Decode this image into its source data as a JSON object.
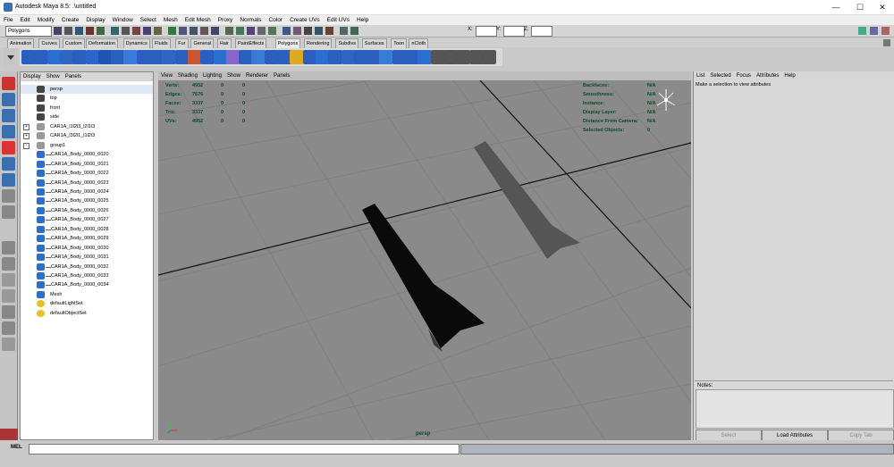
{
  "window": {
    "title": "Autodesk Maya 8.5: .\\untitled",
    "minimize": "—",
    "maximize": "☐",
    "close": "✕"
  },
  "menubar": [
    "File",
    "Edit",
    "Modify",
    "Create",
    "Display",
    "Window",
    "Select",
    "Mesh",
    "Edit Mesh",
    "Proxy",
    "Normals",
    "Color",
    "Create UVs",
    "Edit UVs",
    "Help"
  ],
  "statusline": {
    "mode": "Polygons",
    "x_label": "X:",
    "y_label": "Y:",
    "z_label": "Z:"
  },
  "shelf_tabs": [
    "Animation",
    "Curves",
    "Custom",
    "Deformation",
    "Dynamics",
    "Fluids",
    "Fur",
    "General",
    "Hair",
    "PaintEffects",
    "Polygons",
    "Rendering",
    "Subdivs",
    "Surfaces",
    "Toon",
    "nCloth"
  ],
  "shelf_active": "Polygons",
  "outliner": {
    "menu": [
      "Display",
      "Show",
      "Panels"
    ],
    "items": [
      {
        "label": "persp",
        "icon": "camera-icon",
        "indent": 1,
        "selected": true
      },
      {
        "label": "top",
        "icon": "camera-icon",
        "indent": 1
      },
      {
        "label": "front",
        "icon": "camera-icon",
        "indent": 1
      },
      {
        "label": "side",
        "icon": "camera-icon",
        "indent": 1
      },
      {
        "label": "CAR1A_l1l2l3_l2l1l3",
        "icon": "transform-icon",
        "indent": 1,
        "expander": "+"
      },
      {
        "label": "CAR1A_l3l2l1_l1l2l3",
        "icon": "transform-icon",
        "indent": 1,
        "expander": "+"
      },
      {
        "label": "group1",
        "icon": "transform-icon",
        "indent": 1,
        "expander": "-"
      },
      {
        "label": "CAR1A_Body_0000_0020",
        "icon": "mesh-icon",
        "indent": 2
      },
      {
        "label": "CAR1A_Body_0000_0021",
        "icon": "mesh-icon",
        "indent": 2
      },
      {
        "label": "CAR1A_Body_0000_0022",
        "icon": "mesh-icon",
        "indent": 2
      },
      {
        "label": "CAR1A_Body_0000_0023",
        "icon": "mesh-icon",
        "indent": 2
      },
      {
        "label": "CAR1A_Body_0000_0024",
        "icon": "mesh-icon",
        "indent": 2
      },
      {
        "label": "CAR1A_Body_0000_0025",
        "icon": "mesh-icon",
        "indent": 2
      },
      {
        "label": "CAR1A_Body_0000_0026",
        "icon": "mesh-icon",
        "indent": 2
      },
      {
        "label": "CAR1A_Body_0000_0027",
        "icon": "mesh-icon",
        "indent": 2
      },
      {
        "label": "CAR1A_Body_0000_0028",
        "icon": "mesh-icon",
        "indent": 2
      },
      {
        "label": "CAR1A_Body_0000_0029",
        "icon": "mesh-icon",
        "indent": 2
      },
      {
        "label": "CAR1A_Body_0000_0030",
        "icon": "mesh-icon",
        "indent": 2
      },
      {
        "label": "CAR1A_Body_0000_0031",
        "icon": "mesh-icon",
        "indent": 2
      },
      {
        "label": "CAR1A_Body_0000_0032",
        "icon": "mesh-icon",
        "indent": 2
      },
      {
        "label": "CAR1A_Body_0000_0033",
        "icon": "mesh-icon",
        "indent": 2
      },
      {
        "label": "CAR1A_Body_0000_0034",
        "icon": "mesh-icon",
        "indent": 2
      },
      {
        "label": "Mesh",
        "icon": "mesh-icon",
        "indent": 1
      },
      {
        "label": "defaultLightSet",
        "icon": "set-icon",
        "indent": 1
      },
      {
        "label": "defaultObjectSet",
        "icon": "set-icon",
        "indent": 1
      }
    ]
  },
  "viewport": {
    "menu": [
      "View",
      "Shading",
      "Lighting",
      "Show",
      "Renderer",
      "Panels"
    ],
    "camera_label": "persp",
    "hud_left": [
      {
        "label": "Verts:",
        "v1": "4952",
        "v2": "0",
        "v3": "0"
      },
      {
        "label": "Edges:",
        "v1": "7676",
        "v2": "0",
        "v3": "0"
      },
      {
        "label": "Faces:",
        "v1": "3337",
        "v2": "0",
        "v3": "0"
      },
      {
        "label": "Tris:",
        "v1": "3337",
        "v2": "0",
        "v3": "0"
      },
      {
        "label": "UVs:",
        "v1": "4952",
        "v2": "0",
        "v3": "0"
      }
    ],
    "hud_right": [
      {
        "label": "Backfaces:",
        "value": "N/A"
      },
      {
        "label": "Smoothness:",
        "value": "N/A"
      },
      {
        "label": "Instance:",
        "value": "N/A"
      },
      {
        "label": "Display Layer:",
        "value": "N/A"
      },
      {
        "label": "Distance From Camera:",
        "value": "N/A"
      },
      {
        "label": "Selected Objects:",
        "value": "0"
      }
    ]
  },
  "attribute_editor": {
    "menu": [
      "List",
      "Selected",
      "Focus",
      "Attributes",
      "Help"
    ],
    "message": "Make a selection to view attributes",
    "notes_label": "Notes:",
    "buttons": {
      "select": "Select",
      "load": "Load Attributes",
      "copy": "Copy Tab"
    }
  },
  "command_line": {
    "label": "MEL"
  }
}
